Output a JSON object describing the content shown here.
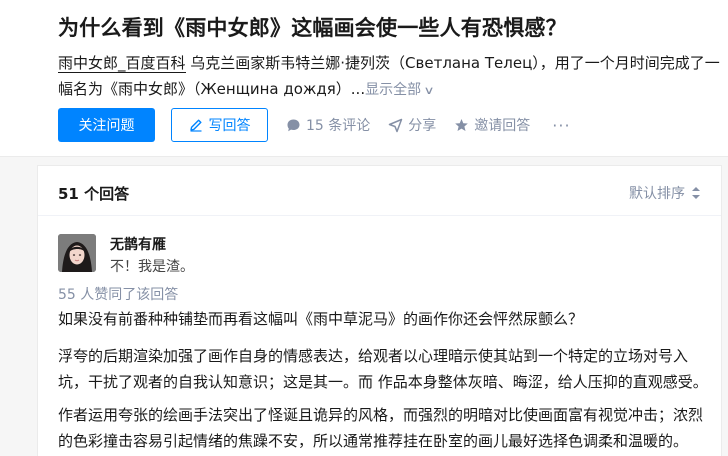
{
  "question": {
    "title": "为什么看到《雨中女郎》这幅画会使一些人有恐惧感？",
    "detail_link": "雨中女郎_百度百科",
    "detail_text": " 乌克兰画家斯韦特兰娜·捷列茨（Светлана Телец），用了一个月时间完成了一幅名为《雨中女郎》（Женщина дождя）...",
    "show_all": "显示全部"
  },
  "actions": {
    "follow": "关注问题",
    "write": "写回答",
    "comments": "15 条评论",
    "share": "分享",
    "invite": "邀请回答",
    "more": "···"
  },
  "answers": {
    "count": "51 个回答",
    "sort": "默认排序"
  },
  "answer": {
    "author": "无鹊有雁",
    "bio": "不！我是渣。",
    "votes": "55 人赞同了该回答",
    "paragraphs": [
      "如果没有前番种种铺垫而再看这幅叫《雨中草泥马》的画作你还会怦然尿颤么？",
      "浮夸的后期渲染加强了画作自身的情感表达，给观者以心理暗示使其站到一个特定的立场对号入坑，干扰了观者的自我认知意识；这是其一。而 作品本身整体灰暗、晦涩，给人压抑的直观感受。",
      "作者运用夸张的绘画手法突出了怪诞且诡异的风格，而强烈的明暗对比使画面富有视觉冲击；浓烈的色彩撞击容易引起情绪的焦躁不安，所以通常推荐挂在卧室的画儿最好选择色调柔和温暖的。"
    ]
  },
  "colors": {
    "accent": "#0084ff",
    "muted": "#8590a6",
    "background": "#f6f6f6"
  }
}
